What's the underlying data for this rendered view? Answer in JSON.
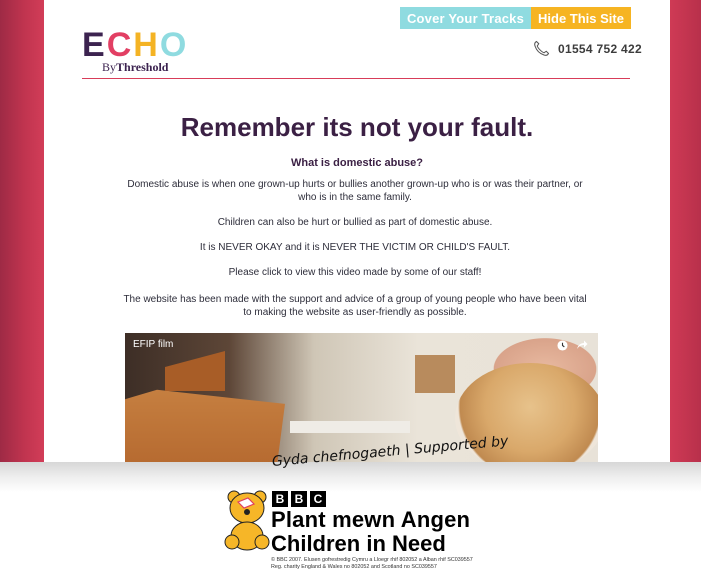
{
  "header": {
    "cover_tracks_label": "Cover Your Tracks",
    "hide_site_label": "Hide This Site",
    "logo": {
      "letters": [
        "E",
        "C",
        "H",
        "O"
      ],
      "by_prefix": "By",
      "by_name": "Threshold"
    },
    "phone_number": "01554 752 422",
    "phone_icon": "phone-icon"
  },
  "content": {
    "heading": "Remember its not your fault.",
    "subheading": "What is domestic abuse?",
    "paragraphs": [
      "Domestic abuse is when one grown-up hurts or bullies another grown-up who is or was their partner, or who is in the same family.",
      "Children can also be hurt or bullied as part of domestic abuse.",
      "It is NEVER OKAY and it is NEVER THE VICTIM OR CHILD'S FAULT.",
      "Please click to view this video made by some of our staff!",
      "The website has been made with the support and advice of a group of young people who have been vital to making the website as user-friendly as possible."
    ]
  },
  "video": {
    "title": "EFIP film",
    "icons": [
      "clock-icon",
      "share-icon"
    ]
  },
  "sponsor": {
    "supported_by": "Gyda chefnogaeth | Supported by",
    "bbc_letters": [
      "B",
      "B",
      "C"
    ],
    "welsh_name": "Plant mewn Angen",
    "english_name": "Children in Need",
    "legal_line1": "© BBC 2007. Elusen gofrestredig Cymru a Lloegr rhif 802052 a Alban rhif SC039557",
    "legal_line2": "Reg. charity England & Wales no 802052 and Scotland no SC039557"
  },
  "colors": {
    "brand_purple": "#3b2044",
    "brand_crimson": "#d23d58",
    "brand_yellow": "#f4b324",
    "brand_aqua": "#8fdbe0"
  }
}
